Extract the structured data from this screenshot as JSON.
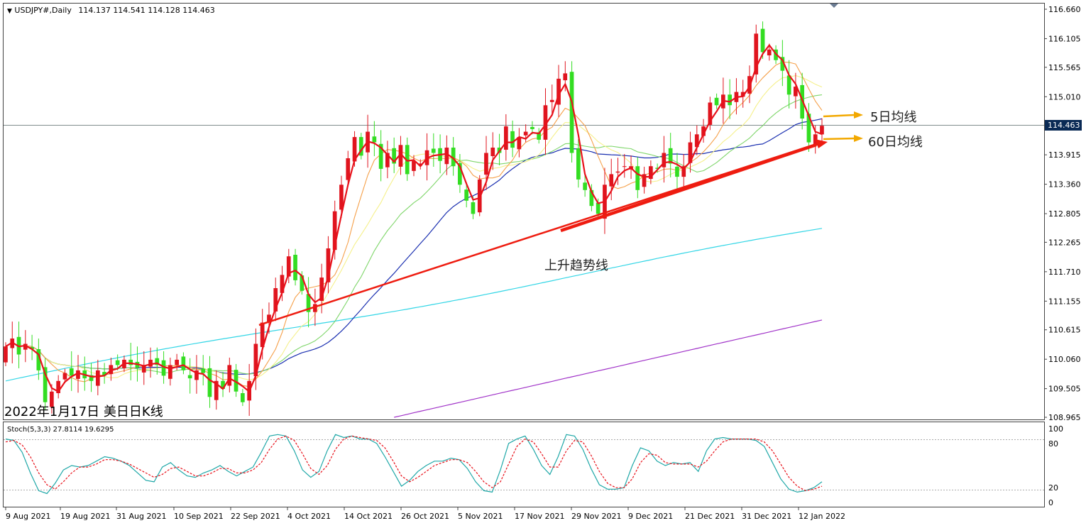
{
  "header": {
    "symbol": "USDJPY#,Daily",
    "ohlc": "114.137 114.541 114.128 114.463"
  },
  "caption": "2022年1月17日 美日日K线",
  "annotations": {
    "ma5_label": "5日均线",
    "ma60_label": "60日均线",
    "trendline_label": "上升趋势线"
  },
  "colors": {
    "bull": "#e0141e",
    "bear": "#33dd22",
    "ma5": "#e8111a",
    "ma10": "#f5a04a",
    "ma20": "#f5f08a",
    "ma30": "#7fd66a",
    "ma60": "#1a2fb0",
    "ma120": "#33d6e6",
    "ma250": "#a032c8",
    "trend": "#ee1c10",
    "arrow": "#f2a800",
    "stoch_main": "#20a8a8",
    "stoch_signal": "#e8111a",
    "price_tag": "#0a2a55"
  },
  "chart_data": [
    {
      "type": "candlestick",
      "title": "USDJPY#,Daily",
      "current_price": "114.463",
      "ylim": [
        108.965,
        116.66
      ],
      "y_ticks": [
        "116.660",
        "116.105",
        "115.565",
        "115.010",
        "114.463",
        "113.915",
        "113.360",
        "112.805",
        "112.265",
        "111.710",
        "111.155",
        "110.615",
        "110.060",
        "109.505",
        "108.965"
      ],
      "x_ticks": [
        "9 Aug 2021",
        "19 Aug 2021",
        "31 Aug 2021",
        "10 Sep 2021",
        "22 Sep 2021",
        "4 Oct 2021",
        "14 Oct 2021",
        "26 Oct 2021",
        "5 Nov 2021",
        "17 Nov 2021",
        "29 Nov 2021",
        "9 Dec 2021",
        "21 Dec 2021",
        "31 Dec 2021",
        "12 Jan 2022"
      ],
      "close": [
        110.3,
        110.45,
        110.15,
        110.35,
        110.25,
        109.85,
        109.25,
        109.45,
        109.65,
        109.8,
        109.75,
        109.85,
        109.7,
        109.65,
        109.85,
        109.75,
        109.95,
        109.95,
        110.05,
        109.95,
        109.9,
        109.95,
        110.05,
        109.95,
        109.75,
        109.95,
        110.05,
        109.85,
        109.7,
        109.85,
        109.8,
        109.35,
        109.65,
        109.5,
        109.95,
        109.45,
        109.25,
        109.65,
        110.35,
        110.75,
        110.9,
        111.4,
        111.65,
        112.0,
        111.55,
        111.35,
        110.95,
        111.1,
        111.6,
        112.15,
        112.85,
        113.35,
        113.85,
        114.25,
        113.9,
        114.35,
        114.15,
        113.65,
        113.95,
        113.75,
        114.1,
        113.55,
        113.8,
        113.75,
        114.0,
        113.95,
        113.8,
        114.05,
        113.7,
        113.35,
        113.05,
        112.8,
        113.45,
        113.95,
        114.05,
        113.95,
        114.45,
        114.05,
        114.25,
        114.35,
        114.4,
        114.2,
        114.85,
        114.95,
        115.35,
        115.45,
        113.95,
        113.45,
        113.25,
        112.95,
        112.8,
        113.35,
        113.55,
        113.6,
        113.7,
        113.7,
        113.25,
        113.55,
        113.7,
        113.65,
        113.95,
        113.75,
        113.5,
        113.7,
        114.15,
        114.3,
        114.45,
        114.9,
        114.85,
        115.05,
        114.85,
        115.1,
        115.1,
        115.4,
        116.2,
        115.85,
        115.9,
        115.7,
        115.5,
        115.05,
        115.2,
        114.6,
        114.15,
        114.3,
        114.463
      ]
    },
    {
      "type": "line",
      "title": "Stoch(5,3,3) 27.8114 19.6295",
      "ylim": [
        0,
        100
      ],
      "y_ticks": [
        "100",
        "80",
        "20",
        "0"
      ],
      "series": [
        {
          "name": "main",
          "values": [
            86,
            84,
            68,
            40,
            16,
            12,
            26,
            44,
            50,
            48,
            50,
            56,
            62,
            60,
            56,
            50,
            40,
            30,
            28,
            48,
            54,
            44,
            36,
            34,
            40,
            44,
            50,
            42,
            36,
            42,
            48,
            68,
            90,
            92,
            90,
            70,
            44,
            34,
            42,
            70,
            92,
            88,
            90,
            86,
            86,
            80,
            62,
            42,
            22,
            30,
            42,
            50,
            56,
            56,
            60,
            58,
            46,
            28,
            16,
            14,
            44,
            80,
            86,
            90,
            72,
            50,
            38,
            62,
            92,
            90,
            72,
            46,
            24,
            18,
            18,
            20,
            50,
            74,
            70,
            56,
            50,
            54,
            52,
            54,
            42,
            70,
            86,
            88,
            86,
            86,
            86,
            84,
            76,
            54,
            32,
            18,
            14,
            16,
            20,
            28
          ]
        },
        {
          "name": "signal",
          "values": [
            82,
            84,
            78,
            62,
            40,
            24,
            18,
            28,
            40,
            48,
            48,
            52,
            58,
            58,
            56,
            52,
            46,
            40,
            34,
            38,
            46,
            48,
            42,
            36,
            36,
            40,
            46,
            46,
            40,
            40,
            44,
            54,
            72,
            86,
            90,
            84,
            66,
            46,
            38,
            50,
            72,
            86,
            90,
            88,
            86,
            84,
            74,
            56,
            36,
            28,
            34,
            42,
            50,
            54,
            58,
            58,
            54,
            42,
            28,
            20,
            28,
            52,
            76,
            86,
            82,
            66,
            48,
            48,
            70,
            84,
            82,
            64,
            42,
            26,
            20,
            20,
            32,
            54,
            66,
            64,
            54,
            52,
            52,
            52,
            48,
            56,
            70,
            82,
            86,
            86,
            86,
            86,
            82,
            70,
            52,
            34,
            22,
            16,
            18,
            22
          ]
        }
      ]
    }
  ]
}
